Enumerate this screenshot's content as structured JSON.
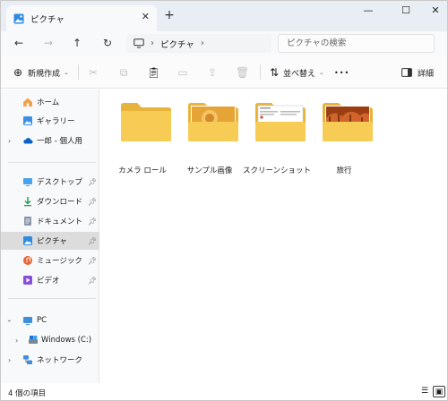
{
  "window": {
    "tab_title": "ピクチャ",
    "tab_close": "✕",
    "new_tab": "+",
    "minimize": "—",
    "maximize": "☐",
    "close": "✕"
  },
  "nav": {
    "back": "←",
    "forward": "→",
    "up": "↑",
    "refresh": "↻",
    "breadcrumb": [
      "ピクチャ"
    ],
    "separator": "›",
    "search_placeholder": "ピクチャの検索"
  },
  "toolbar": {
    "new_label": "新規作成",
    "sort_label": "並べ替え",
    "more_label": "•••",
    "details_label": "詳細"
  },
  "sidebar": {
    "home": "ホーム",
    "gallery": "ギャラリー",
    "onedrive": "一郎 - 個人用",
    "quick_access": [
      {
        "label": "デスクトップ",
        "icon": "desktop-icon"
      },
      {
        "label": "ダウンロード",
        "icon": "download-icon"
      },
      {
        "label": "ドキュメント",
        "icon": "document-icon"
      },
      {
        "label": "ピクチャ",
        "icon": "pictures-icon",
        "selected": true
      },
      {
        "label": "ミュージック",
        "icon": "music-icon"
      },
      {
        "label": "ビデオ",
        "icon": "video-icon"
      }
    ],
    "pc": "PC",
    "drive": "Windows (C:)",
    "network": "ネットワーク"
  },
  "folders": [
    {
      "name": "カメラ ロール",
      "thumbnail": "none"
    },
    {
      "name": "サンプル画像",
      "thumbnail": "image"
    },
    {
      "name": "スクリーンショット",
      "thumbnail": "screenshot"
    },
    {
      "name": "旅行",
      "thumbnail": "autumn-photo"
    }
  ],
  "status": {
    "item_count": "4 個の項目"
  },
  "colors": {
    "accent": "#0067c0",
    "folder_yellow": "#f5c542",
    "folder_back": "#e8b33a",
    "selected_bg": "#dcdcdc"
  }
}
